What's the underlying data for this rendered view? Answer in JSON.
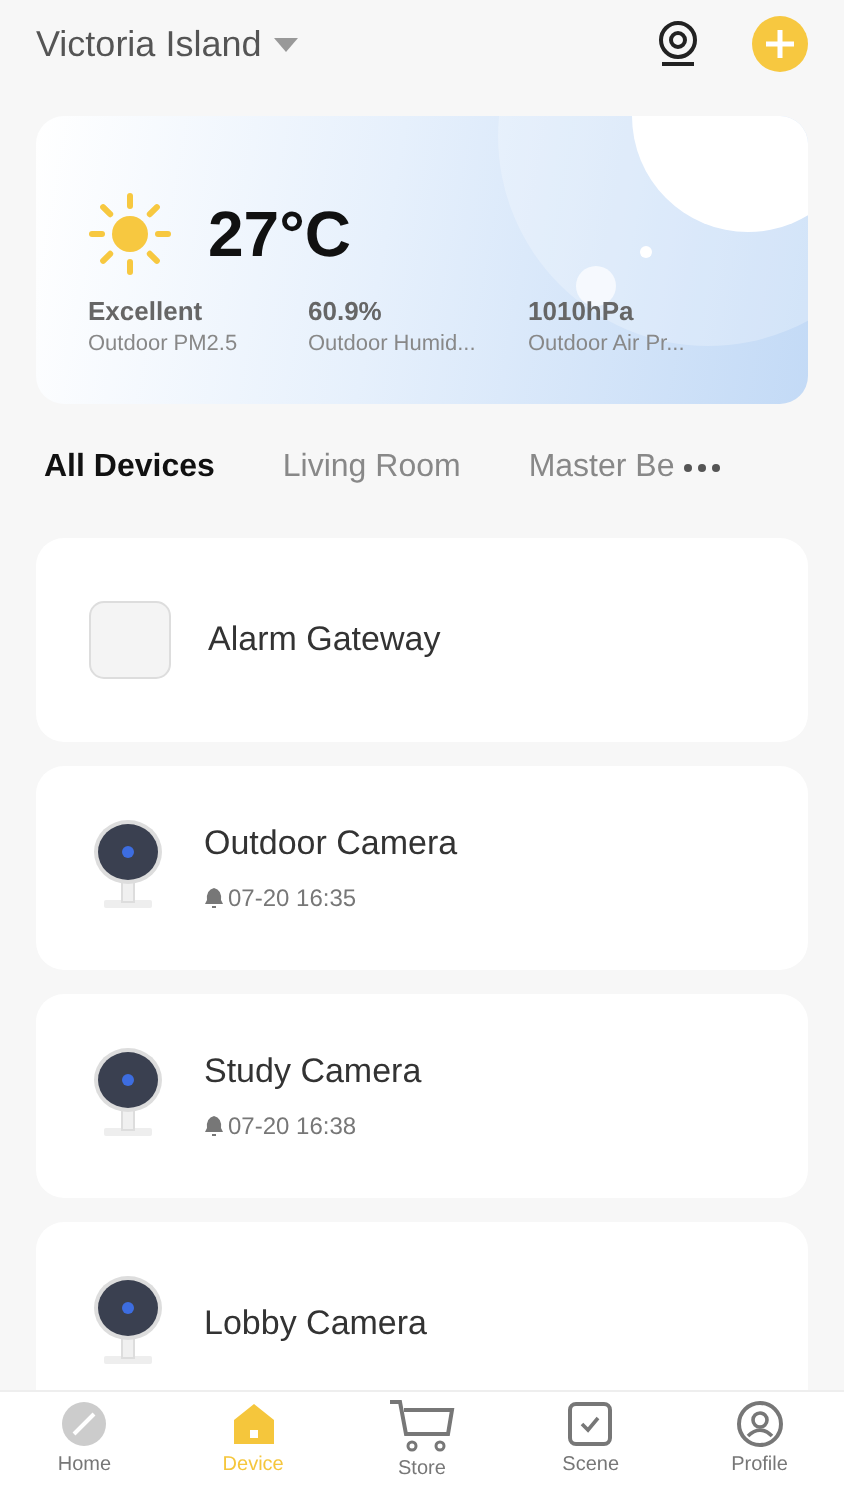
{
  "header": {
    "location": "Victoria Island"
  },
  "weather": {
    "temperature": "27°C",
    "stats": [
      {
        "value": "Excellent",
        "label": "Outdoor PM2.5"
      },
      {
        "value": "60.9%",
        "label": "Outdoor Humid..."
      },
      {
        "value": "1010hPa",
        "label": "Outdoor Air Pr..."
      }
    ]
  },
  "tabs": [
    {
      "label": "All Devices",
      "selected": true
    },
    {
      "label": "Living Room",
      "selected": false
    },
    {
      "label": "Master Be",
      "selected": false
    }
  ],
  "devices": [
    {
      "kind": "gateway",
      "name": "Alarm Gateway"
    },
    {
      "kind": "camera",
      "name": "Outdoor Camera",
      "alert_time": "07-20 16:35"
    },
    {
      "kind": "camera",
      "name": "Study Camera",
      "alert_time": "07-20 16:38"
    },
    {
      "kind": "camera",
      "name": "Lobby Camera"
    }
  ],
  "nav": [
    {
      "kind": "home",
      "label": "Home",
      "selected": false
    },
    {
      "kind": "device",
      "label": "Device",
      "selected": true
    },
    {
      "kind": "store",
      "label": "Store",
      "selected": false
    },
    {
      "kind": "scene",
      "label": "Scene",
      "selected": false
    },
    {
      "kind": "profile",
      "label": "Profile",
      "selected": false
    }
  ]
}
